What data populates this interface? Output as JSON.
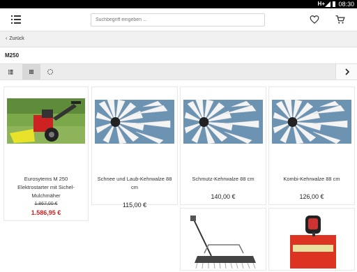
{
  "status": {
    "network": "H+",
    "time": "08:30"
  },
  "search": {
    "placeholder": "Suchbegriff eingeben ..."
  },
  "back": {
    "label": "Zurück"
  },
  "page": {
    "title": "M250"
  },
  "products": [
    {
      "name": "Eurosytems M 250 Elektrostarter mit Sichel-Mulchmäher",
      "old_price": "1.867,00 €",
      "price": "1.586,95 €"
    },
    {
      "name": "Schnee und Laub-Kehrwalze 88 cm",
      "price": "115,00 €"
    },
    {
      "name": "Schmutz-Kehrwalze 88 cm",
      "price": "140,00 €"
    },
    {
      "name": "Kombi-Kehrwalze 88 cm",
      "price": "126,00 €"
    }
  ],
  "icons": {
    "menu": "menu-icon",
    "favorites": "heart-icon",
    "cart": "cart-icon",
    "list_view": "list-view-icon",
    "grid_view": "grid-view-icon",
    "sort": "sort-icon",
    "next": "chevron-right-icon"
  },
  "colors": {
    "sale": "#cc2222",
    "statusbar": "#000000"
  }
}
